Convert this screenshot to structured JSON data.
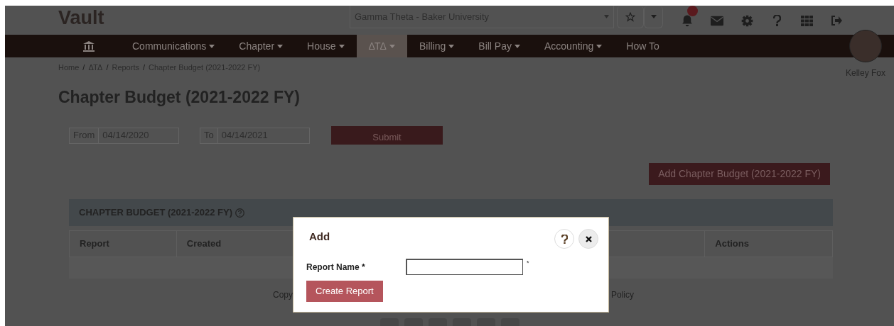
{
  "header": {
    "logo": "Vault",
    "organization_select": {
      "value": "Gamma Theta - Baker University"
    },
    "notifications_badge": true
  },
  "nav": {
    "items": [
      {
        "label": "Communications",
        "dropdown": true,
        "selected": false
      },
      {
        "label": "Chapter",
        "dropdown": true,
        "selected": false
      },
      {
        "label": "House",
        "dropdown": true,
        "selected": false
      },
      {
        "label": "ΔΤΔ",
        "dropdown": true,
        "selected": true
      },
      {
        "label": "Billing",
        "dropdown": true,
        "selected": false
      },
      {
        "label": "Bill Pay",
        "dropdown": true,
        "selected": false
      },
      {
        "label": "Accounting",
        "dropdown": true,
        "selected": false
      },
      {
        "label": "How To",
        "dropdown": false,
        "selected": false
      }
    ]
  },
  "user": {
    "name": "Kelley Fox"
  },
  "breadcrumb": {
    "separator": "/",
    "items": [
      "Home",
      "ΔΤΔ",
      "Reports",
      "Chapter Budget (2021-2022 FY)"
    ]
  },
  "page_title": "Chapter Budget (2021-2022 FY)",
  "filters": [
    {
      "label": "From",
      "value": "04/14/2020"
    },
    {
      "label": "To",
      "value": "04/14/2021"
    }
  ],
  "submit_button": "Submit",
  "add_button": "Add Chapter Budget (2021-2022 FY)",
  "panel": {
    "title": "CHAPTER BUDGET (2021-2022 FY)",
    "columns": [
      "Report",
      "Created",
      "Actions"
    ]
  },
  "footer": {
    "left_text": "Copy",
    "right_text": "Policy"
  },
  "modal": {
    "title": "Add",
    "field": {
      "label": "Report Name *",
      "required_mark": "*"
    },
    "button": "Create Report"
  }
}
